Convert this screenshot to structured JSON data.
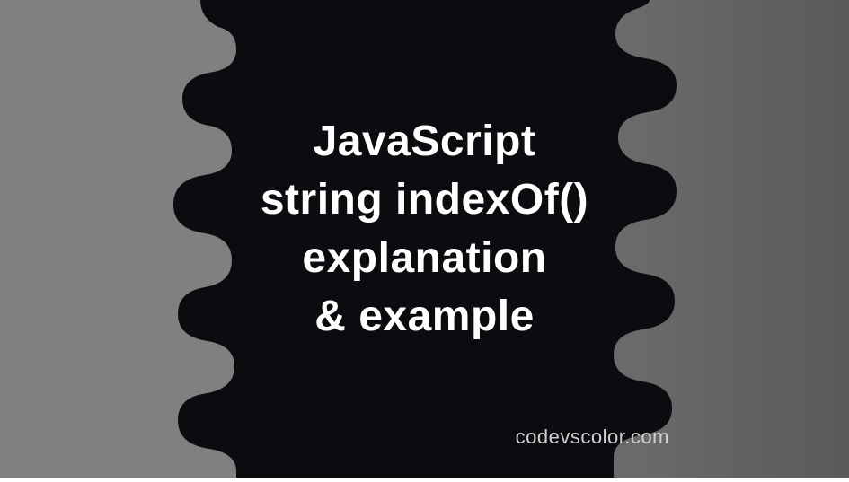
{
  "banner": {
    "title_line1": "JavaScript",
    "title_line2": "string indexOf()",
    "title_line3": "explanation",
    "title_line4": "& example"
  },
  "watermark": "codevscolor.com",
  "colors": {
    "blob": "#0c0c10",
    "text": "#ffffff",
    "watermark": "#d0d0d0",
    "bg_left": "#808080",
    "bg_right": "#5a5a5a"
  }
}
